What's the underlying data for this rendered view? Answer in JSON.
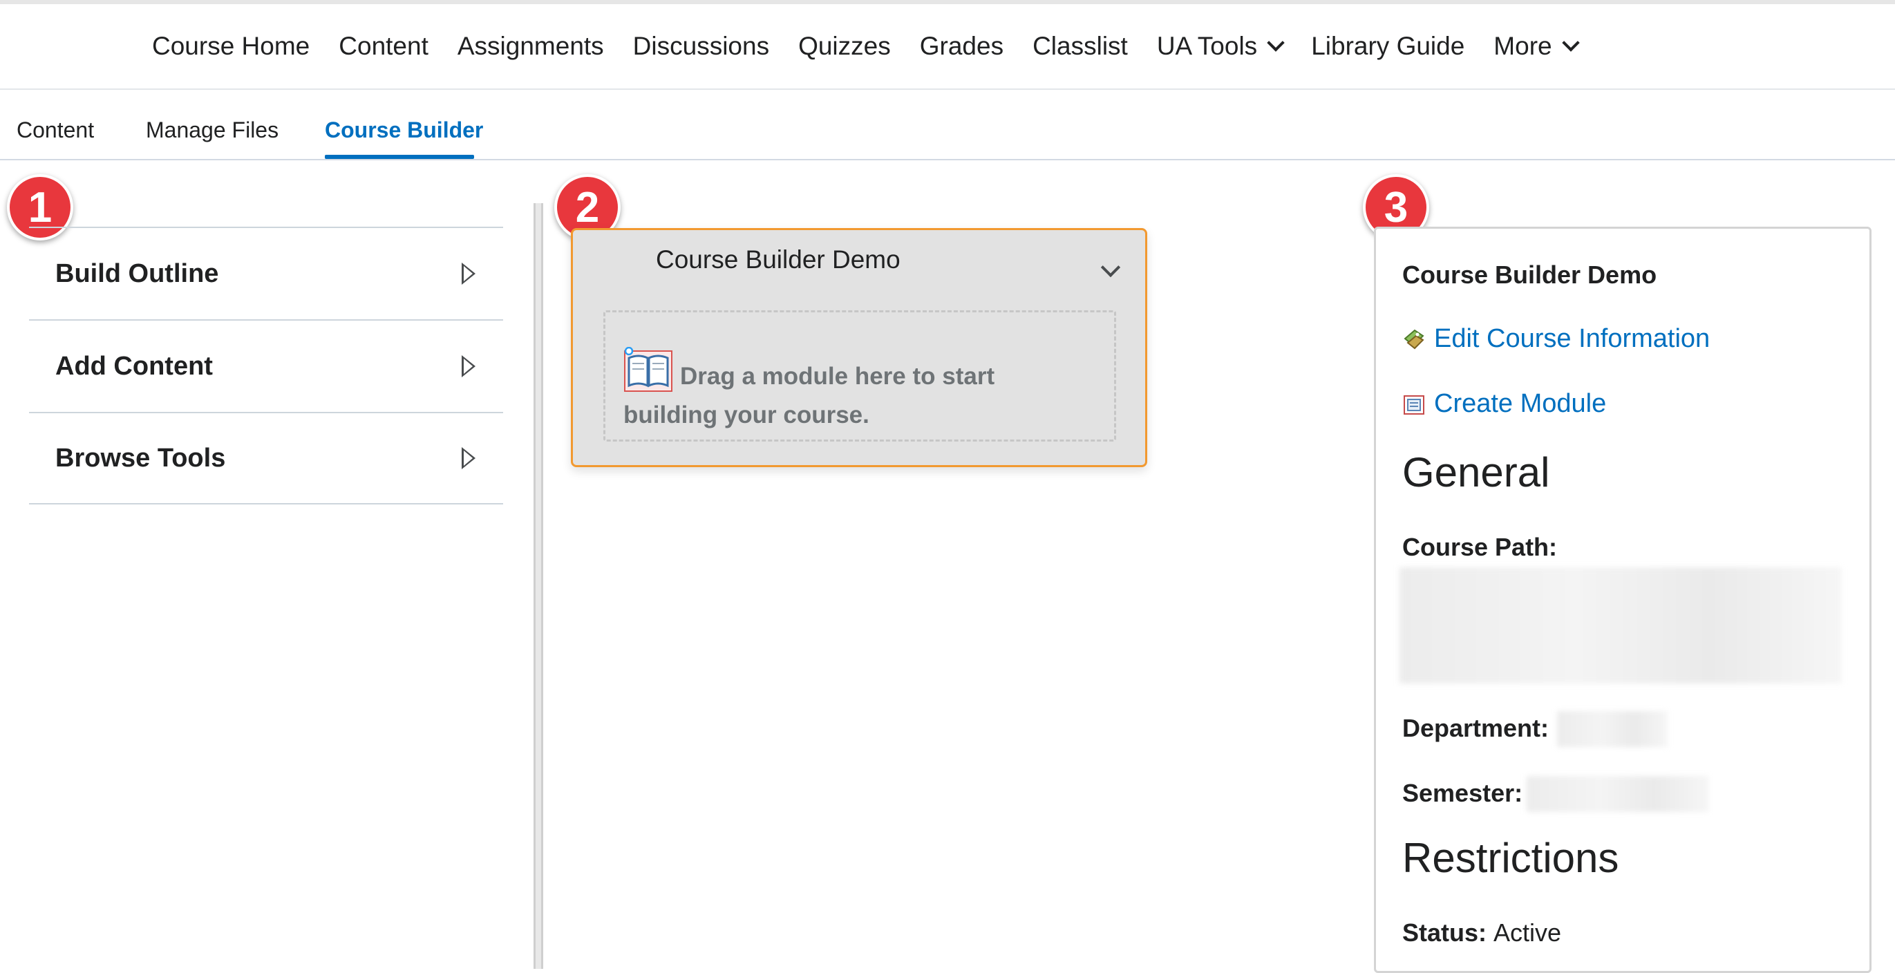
{
  "nav": {
    "items": [
      {
        "label": "Course Home",
        "dropdown": false
      },
      {
        "label": "Content",
        "dropdown": false
      },
      {
        "label": "Assignments",
        "dropdown": false
      },
      {
        "label": "Discussions",
        "dropdown": false
      },
      {
        "label": "Quizzes",
        "dropdown": false
      },
      {
        "label": "Grades",
        "dropdown": false
      },
      {
        "label": "Classlist",
        "dropdown": false
      },
      {
        "label": "UA Tools",
        "dropdown": true
      },
      {
        "label": "Library Guide",
        "dropdown": false
      },
      {
        "label": "More",
        "dropdown": true
      }
    ]
  },
  "subtabs": {
    "content": "Content",
    "manage_files": "Manage Files",
    "course_builder": "Course Builder",
    "active": "Course Builder"
  },
  "badges": {
    "one": "1",
    "two": "2",
    "three": "3"
  },
  "left_panel": {
    "items": [
      {
        "label": "Build Outline"
      },
      {
        "label": "Add Content"
      },
      {
        "label": "Browse Tools"
      }
    ]
  },
  "module": {
    "title": "Course Builder Demo",
    "drop_text": "Drag a module here to start building your course."
  },
  "right_panel": {
    "title": "Course Builder Demo",
    "edit_link": "Edit Course Information",
    "create_link": "Create Module",
    "general_heading": "General",
    "course_path_label": "Course Path:",
    "department_label": "Department:",
    "semester_label": "Semester:",
    "restrictions_heading": "Restrictions",
    "status_label": "Status:",
    "status_value": "Active"
  },
  "colors": {
    "accent": "#006fbf",
    "badge": "#e8373d",
    "module_border": "#f29930"
  }
}
